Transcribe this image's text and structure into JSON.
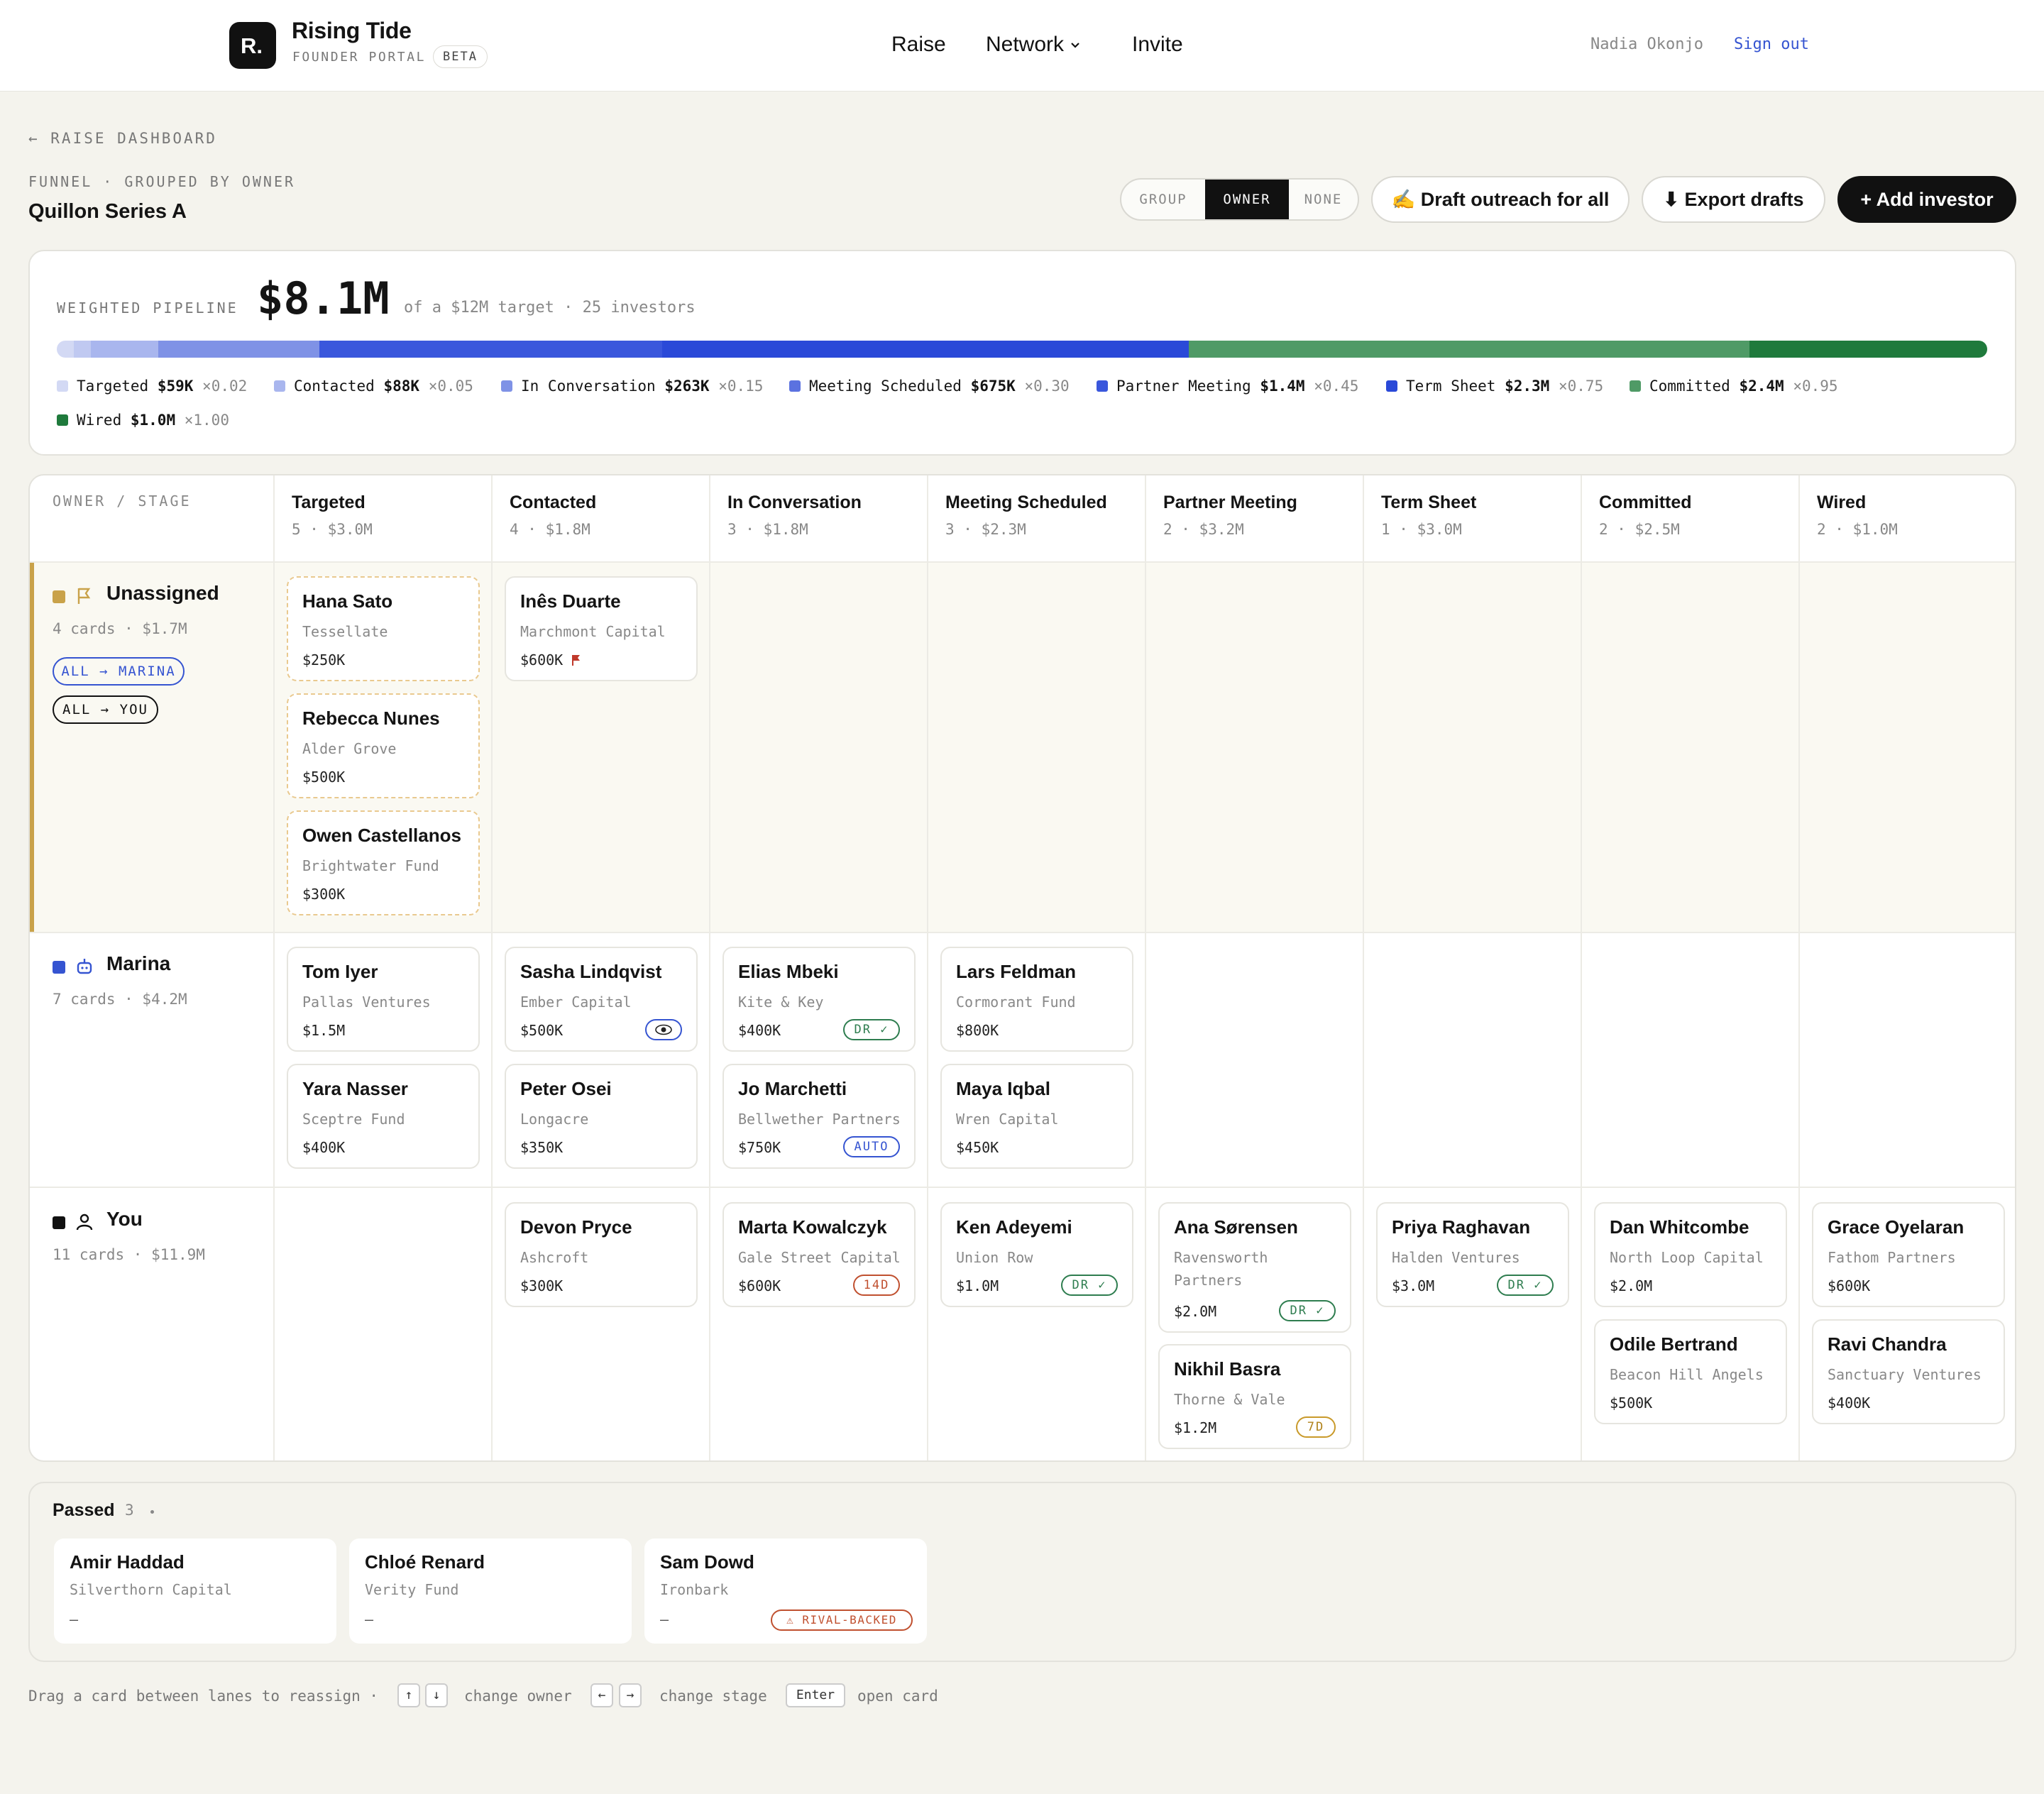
{
  "app": {
    "brand": "Rising Tide",
    "subtitle": "FOUNDER PORTAL",
    "beta": "BETA",
    "logo_letter": "R."
  },
  "nav": {
    "raise": "Raise",
    "network": "Network",
    "invite": "Invite"
  },
  "user": {
    "name": "Nadia Okonjo",
    "sign_out": "Sign out"
  },
  "breadcrumb": "← RAISE DASHBOARD",
  "view": {
    "mode": "FUNNEL · GROUPED BY OWNER",
    "title": "Quillon Series A"
  },
  "group_toggle": {
    "label": "GROUP",
    "options": [
      "OWNER",
      "NONE"
    ],
    "selected": "OWNER"
  },
  "actions": {
    "draft": "✍ Draft outreach for all",
    "export": "⬇ Export drafts",
    "add": "+ Add investor"
  },
  "pipeline": {
    "label": "WEIGHTED PIPELINE",
    "value": "$8.1M",
    "meta": "of a $12M target · 25 investors",
    "weighted_fraction": 0.675,
    "legend": [
      {
        "stage": "Targeted",
        "amount": "$59K",
        "mult": "×0.02",
        "color": "#d3d9f4"
      },
      {
        "stage": "Contacted",
        "amount": "$88K",
        "mult": "×0.05",
        "color": "#a9b6ee"
      },
      {
        "stage": "In Conversation",
        "amount": "$263K",
        "mult": "×0.15",
        "color": "#7f92e6"
      },
      {
        "stage": "Meeting Scheduled",
        "amount": "$675K",
        "mult": "×0.30",
        "color": "#5b72e0"
      },
      {
        "stage": "Partner Meeting",
        "amount": "$1.4M",
        "mult": "×0.45",
        "color": "#3a57dc"
      },
      {
        "stage": "Term Sheet",
        "amount": "$2.3M",
        "mult": "×0.75",
        "color": "#2a49d8"
      },
      {
        "stage": "Committed",
        "amount": "$2.4M",
        "mult": "×0.95",
        "color": "#4f9a66"
      },
      {
        "stage": "Wired",
        "amount": "$1.0M",
        "mult": "×1.00",
        "color": "#1f7a3c"
      }
    ]
  },
  "board": {
    "corner": "OWNER / STAGE",
    "columns": [
      {
        "name": "Targeted",
        "meta": "5 · $3.0M"
      },
      {
        "name": "Contacted",
        "meta": "4 · $1.8M"
      },
      {
        "name": "In Conversation",
        "meta": "3 · $1.8M"
      },
      {
        "name": "Meeting Scheduled",
        "meta": "3 · $2.3M"
      },
      {
        "name": "Partner Meeting",
        "meta": "2 · $3.2M"
      },
      {
        "name": "Term Sheet",
        "meta": "1 · $3.0M"
      },
      {
        "name": "Committed",
        "meta": "2 · $2.5M"
      },
      {
        "name": "Wired",
        "meta": "2 · $1.0M"
      }
    ],
    "lanes": [
      {
        "owner": "Unassigned",
        "meta": "4 cards · $1.7M",
        "color": "#c9a24a",
        "pills": [
          "ALL → MARINA",
          "ALL → YOU"
        ]
      },
      {
        "owner": "Marina",
        "meta": "7 cards · $4.2M",
        "color": "#3554d1"
      },
      {
        "owner": "You",
        "meta": "11 cards · $11.9M",
        "color": "#111111"
      }
    ],
    "cards": [
      {
        "name": "Hana Sato",
        "firm": "Tessellate",
        "amount": "$250K"
      },
      {
        "name": "Rebecca Nunes",
        "firm": "Alder Grove",
        "amount": "$500K"
      },
      {
        "name": "Owen Castellanos",
        "firm": "Brightwater Fund",
        "amount": "$300K"
      },
      {
        "name": "Inês Duarte",
        "firm": "Marchmont Capital",
        "amount": "$600K"
      },
      {
        "name": "Tom Iyer",
        "firm": "Pallas Ventures",
        "amount": "$1.5M"
      },
      {
        "name": "Yara Nasser",
        "firm": "Sceptre Fund",
        "amount": "$400K"
      },
      {
        "name": "Sasha Lindqvist",
        "firm": "Ember Capital",
        "amount": "$500K"
      },
      {
        "name": "Peter Osei",
        "firm": "Longacre",
        "amount": "$350K"
      },
      {
        "name": "Elias Mbeki",
        "firm": "Kite & Key",
        "amount": "$400K",
        "tag": "DR ✓"
      },
      {
        "name": "Jo Marchetti",
        "firm": "Bellwether Partners",
        "amount": "$750K",
        "tag": "AUTO"
      },
      {
        "name": "Lars Feldman",
        "firm": "Cormorant Fund",
        "amount": "$800K"
      },
      {
        "name": "Maya Iqbal",
        "firm": "Wren Capital",
        "amount": "$450K"
      },
      {
        "name": "Devon Pryce",
        "firm": "Ashcroft",
        "amount": "$300K"
      },
      {
        "name": "Marta Kowalczyk",
        "firm": "Gale Street Capital",
        "amount": "$600K",
        "tag": "14D"
      },
      {
        "name": "Ken Adeyemi",
        "firm": "Union Row",
        "amount": "$1.0M",
        "tag": "DR ✓"
      },
      {
        "name": "Ana Sørensen",
        "firm": "Ravensworth Partners",
        "amount": "$2.0M",
        "tag": "DR ✓"
      },
      {
        "name": "Nikhil Basra",
        "firm": "Thorne & Vale",
        "amount": "$1.2M",
        "tag": "7D"
      },
      {
        "name": "Priya Raghavan",
        "firm": "Halden Ventures",
        "amount": "$3.0M",
        "tag": "DR ✓"
      },
      {
        "name": "Dan Whitcombe",
        "firm": "North Loop Capital",
        "amount": "$2.0M"
      },
      {
        "name": "Odile Bertrand",
        "firm": "Beacon Hill Angels",
        "amount": "$500K"
      },
      {
        "name": "Grace Oyelaran",
        "firm": "Fathom Partners",
        "amount": "$600K"
      },
      {
        "name": "Ravi Chandra",
        "firm": "Sanctuary Ventures",
        "amount": "$400K"
      }
    ]
  },
  "passed": {
    "title": "Passed",
    "count": "3",
    "cards": [
      {
        "name": "Amir Haddad",
        "firm": "Silverthorn Capital",
        "amount": "–"
      },
      {
        "name": "Chloé Renard",
        "firm": "Verity Fund",
        "amount": "–"
      },
      {
        "name": "Sam Dowd",
        "firm": "Ironbark",
        "amount": "–",
        "tag": "⚠ RIVAL-BACKED"
      }
    ]
  },
  "footer": {
    "hint": "Drag a card between lanes to reassign ·",
    "keys": {
      "up": "↑",
      "down": "↓",
      "left": "←",
      "right": "→",
      "enter": "Enter"
    },
    "change_owner": "change owner",
    "change_stage": "change stage",
    "open_card": "open card"
  }
}
